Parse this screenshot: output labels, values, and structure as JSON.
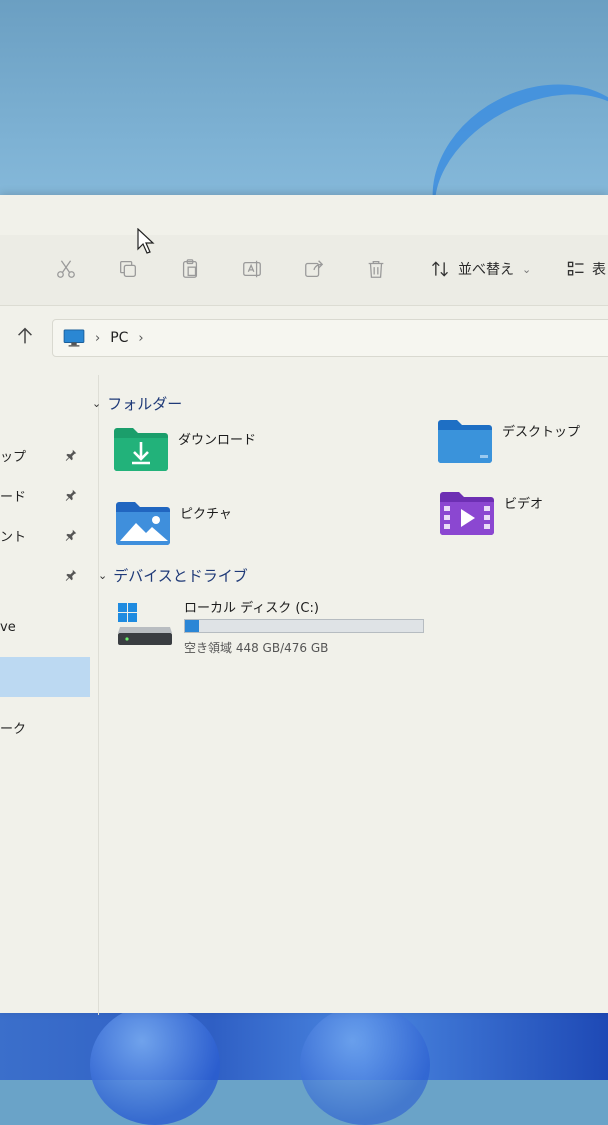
{
  "toolbar": {
    "sort_label": "並べ替え",
    "view_label": "表"
  },
  "address": {
    "segments": [
      "PC"
    ]
  },
  "sidebar": {
    "items": [
      {
        "label": "ップ",
        "pinned": true
      },
      {
        "label": "ード",
        "pinned": true
      },
      {
        "label": "ント",
        "pinned": true
      },
      {
        "label": "",
        "pinned": true
      },
      {
        "label": "ve",
        "pinned": false
      },
      {
        "label": "",
        "pinned": false,
        "selected": true
      },
      {
        "label": "ーク",
        "pinned": false
      }
    ]
  },
  "sections": {
    "folders_title": "フォルダー",
    "devices_title": "デバイスとドライブ"
  },
  "folders": [
    {
      "name": "ダウンロード",
      "icon": "downloads-folder-icon"
    },
    {
      "name": "デスクトップ",
      "icon": "desktop-folder-icon"
    },
    {
      "name": "ピクチャ",
      "icon": "pictures-folder-icon"
    },
    {
      "name": "ビデオ",
      "icon": "videos-folder-icon"
    }
  ],
  "drive": {
    "name": "ローカル ディスク (C:)",
    "free_text": "空き領域 448 GB/476 GB",
    "used_fraction": 0.06
  },
  "colors": {
    "accent": "#2b86d6",
    "selection": "#bcd9f2"
  }
}
